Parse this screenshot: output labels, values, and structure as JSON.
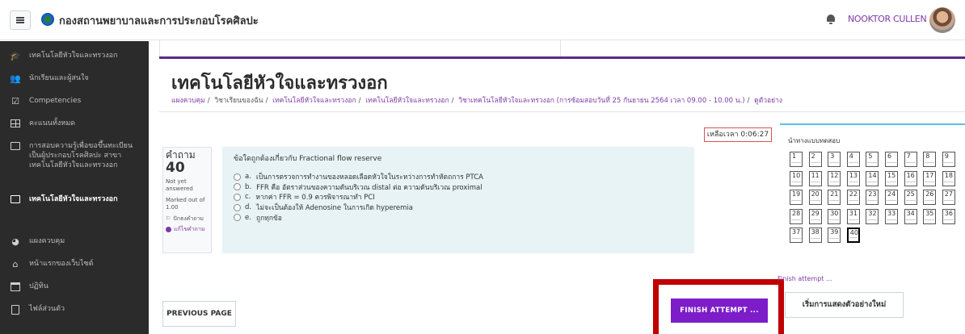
{
  "header": {
    "site_name": "กองสถานพยาบาลและการประกอบโรคศิลปะ",
    "user_name": "NOOKTOR CULLEN"
  },
  "sidebar": {
    "items": [
      {
        "label": "เทคโนโลยีหัวใจและทรวงอก",
        "icon": "graduation-cap-icon"
      },
      {
        "label": "นักเรียนและผู้สนใจ",
        "icon": "users-icon"
      },
      {
        "label": "Competencies",
        "icon": "checkbox-icon"
      },
      {
        "label": "คะแนนทั้งหมด",
        "icon": "table-icon"
      },
      {
        "label": "การสอบความรู้เพื่อขอขึ้นทะเบียนเป็นผู้ประกอบโรคศิลปะ สาขาเทคโนโลยีหัวใจและทรวงอก",
        "icon": "folder-icon"
      },
      {
        "label": "เทคโนโลยีหัวใจและทรวงอก",
        "icon": "folder-icon"
      },
      {
        "label": "แผงควบคุม",
        "icon": "dashboard-icon"
      },
      {
        "label": "หน้าแรกของเว็บไซต์",
        "icon": "home-icon"
      },
      {
        "label": "ปฏิทิน",
        "icon": "calendar-icon"
      },
      {
        "label": "ไฟล์ส่วนตัว",
        "icon": "file-icon"
      }
    ]
  },
  "page": {
    "title": "เทคโนโลยีหัวใจและทรวงอก",
    "breadcrumb": [
      "แผงควบคุม",
      "วิชาเรียนของฉัน",
      "เทคโนโลยีหัวใจและทรวงอก",
      "เทคโนโลยีหัวใจและทรวงอก",
      "วิชาเทคโนโลยีหัวใจและทรวงอก (การซ้อมสอบวันที่ 25 กันยายน 2564 เวลา 09.00 - 10.00 น.)",
      "ดูตัวอย่าง"
    ]
  },
  "timer": {
    "label": "เหลือเวลา",
    "value": "0:06:27"
  },
  "question": {
    "label": "คำถาม",
    "number": "40",
    "state": "Not yet answered",
    "marks": "Marked out of 1.00",
    "flag": "ปักธงคำถาม",
    "edit": "แก้ไขคำถาม",
    "text": "ข้อใดถูกต้องเกี่ยวกับ Fractional flow reserve",
    "answers": [
      {
        "letter": "a.",
        "text": "เป็นการตรวจการทำงานของหลอดเลือดหัวใจในระหว่างการทำหัตถการ PTCA"
      },
      {
        "letter": "b.",
        "text": "FFR คือ อัตราส่วนของความดันบริเวณ distal ต่อ ความดันบริเวณ proximal"
      },
      {
        "letter": "c.",
        "text": "หากค่า FFR = 0.9 ควรพิจารณาทำ PCI"
      },
      {
        "letter": "d.",
        "text": "ไม่จะเป็นต้องให้ Adenosine ในการเกิด hyperemia"
      },
      {
        "letter": "e.",
        "text": "ถูกทุกข้อ"
      }
    ]
  },
  "buttons": {
    "previous": "PREVIOUS PAGE",
    "finish": "FINISH ATTEMPT ...",
    "restart": "เริ่มการแสดงตัวอย่างใหม่"
  },
  "quiz_nav": {
    "title": "นำทางแบบทดสอบ",
    "numbers": [
      "1",
      "2",
      "3",
      "4",
      "5",
      "6",
      "7",
      "8",
      "9",
      "10",
      "11",
      "12",
      "13",
      "14",
      "15",
      "16",
      "17",
      "18",
      "19",
      "20",
      "21",
      "22",
      "23",
      "24",
      "25",
      "26",
      "27",
      "28",
      "29",
      "30",
      "31",
      "32",
      "33",
      "34",
      "35",
      "36",
      "37",
      "38",
      "39",
      "40"
    ],
    "current": "40",
    "finish_link": "Finish attempt ..."
  },
  "colors": {
    "accent": "#7c1dc9",
    "highlight_frame": "#c00000",
    "sidebar_bg": "#2b2b2b",
    "question_bg": "#e7f3f5"
  }
}
